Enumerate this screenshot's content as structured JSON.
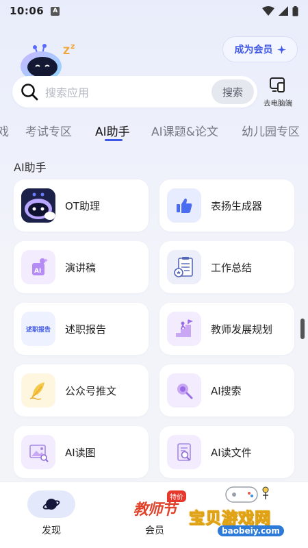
{
  "status_bar": {
    "time": "10:06",
    "notification_icon": "A"
  },
  "header": {
    "member_button": "成为会员"
  },
  "search": {
    "placeholder": "搜索应用",
    "button": "搜索"
  },
  "pc_link": {
    "label": "去电脑端"
  },
  "tabs": [
    "戏",
    "考试专区",
    "AI助手",
    "AI课题&论文",
    "幼儿园专区"
  ],
  "active_tab": "AI助手",
  "section": {
    "title": "AI助手"
  },
  "cards": [
    {
      "label": "OT助理",
      "icon": "robot-mascot-icon"
    },
    {
      "label": "表扬生成器",
      "icon": "thumbs-up-icon"
    },
    {
      "label": "演讲稿",
      "icon": "ai-speech-icon"
    },
    {
      "label": "工作总结",
      "icon": "checklist-report-icon"
    },
    {
      "label": "述职报告",
      "icon": "report-badge-icon",
      "badge_text": "述职报告"
    },
    {
      "label": "教师发展规划",
      "icon": "growth-stairs-icon"
    },
    {
      "label": "公众号推文",
      "icon": "feather-pen-icon"
    },
    {
      "label": "AI搜索",
      "icon": "magnifier-icon"
    },
    {
      "label": "AI读图",
      "icon": "image-reader-icon"
    },
    {
      "label": "AI读文件",
      "icon": "file-reader-icon"
    }
  ],
  "bottom_nav": {
    "discover": "发现",
    "member": "会员",
    "member_badge": "教师节",
    "member_tag": "特价"
  },
  "watermark": {
    "text": "宝贝游戏网",
    "url": "baobeiy.com"
  },
  "colors": {
    "accent": "#3d56e6",
    "background": "#eef1fb",
    "card": "#ffffff",
    "teacher_day_red": "#e0432a"
  }
}
